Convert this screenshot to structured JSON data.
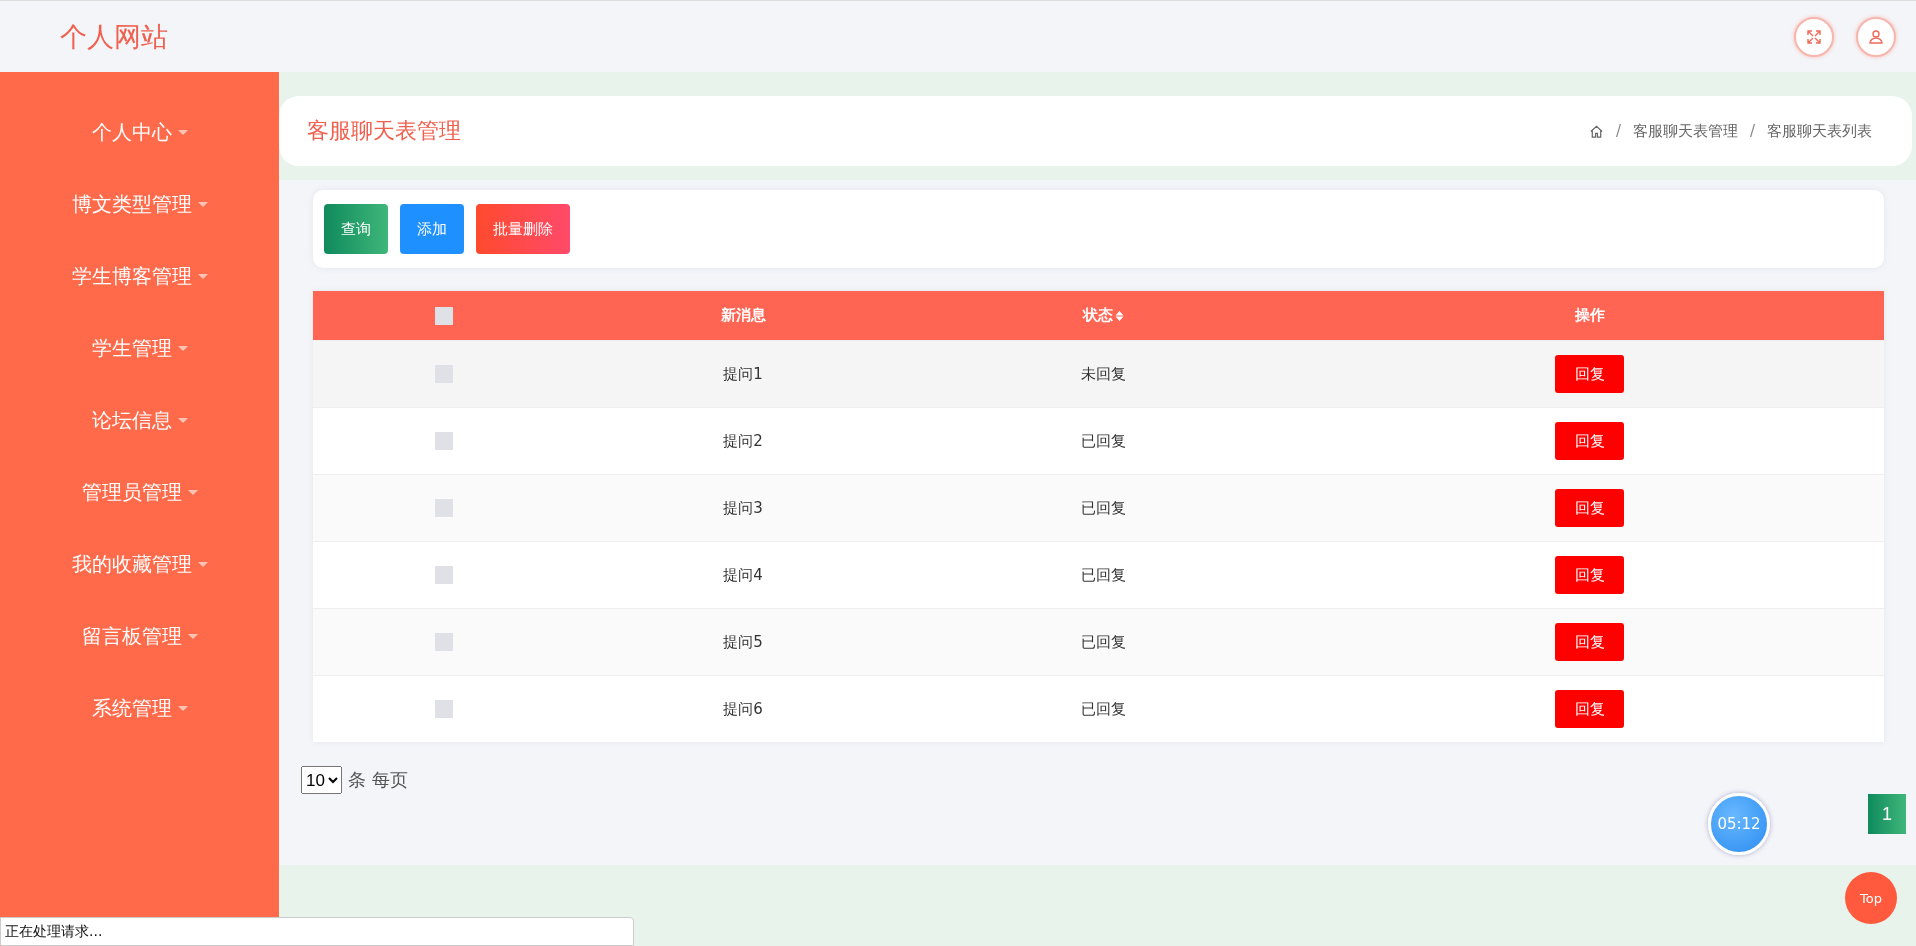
{
  "site_title": "个人网站",
  "sidebar": {
    "items": [
      {
        "label": "个人中心"
      },
      {
        "label": "博文类型管理"
      },
      {
        "label": "学生博客管理"
      },
      {
        "label": "学生管理"
      },
      {
        "label": "论坛信息"
      },
      {
        "label": "管理员管理"
      },
      {
        "label": "我的收藏管理"
      },
      {
        "label": "留言板管理"
      },
      {
        "label": "系统管理"
      }
    ]
  },
  "page_title": "客服聊天表管理",
  "breadcrumb": [
    "客服聊天表管理",
    "客服聊天表列表"
  ],
  "breadcrumb_separator": "/",
  "toolbar": [
    {
      "label": "查询",
      "kind": "search"
    },
    {
      "label": "添加",
      "kind": "add"
    },
    {
      "label": "批量删除",
      "kind": "delete"
    }
  ],
  "table": {
    "select_all": {
      "checked": false
    },
    "columns": [
      {
        "label": "新消息",
        "sortable": false
      },
      {
        "label": "状态",
        "sortable": true
      },
      {
        "label": "操作",
        "sortable": false
      }
    ],
    "rows": [
      {
        "checked": false,
        "message": "提问1",
        "status": "未回复",
        "action": "回复"
      },
      {
        "checked": false,
        "message": "提问2",
        "status": "已回复",
        "action": "回复"
      },
      {
        "checked": false,
        "message": "提问3",
        "status": "已回复",
        "action": "回复"
      },
      {
        "checked": false,
        "message": "提问4",
        "status": "已回复",
        "action": "回复"
      },
      {
        "checked": false,
        "message": "提问5",
        "status": "已回复",
        "action": "回复"
      },
      {
        "checked": false,
        "message": "提问6",
        "status": "已回复",
        "action": "回复"
      }
    ]
  },
  "pagination": {
    "page_size": "10",
    "page_size_label": "条 每页",
    "pages": [
      {
        "label": "1",
        "selected": true
      }
    ]
  },
  "timer": "05:12",
  "back_to_top": "Top",
  "browser_status": "正在处理请求..."
}
